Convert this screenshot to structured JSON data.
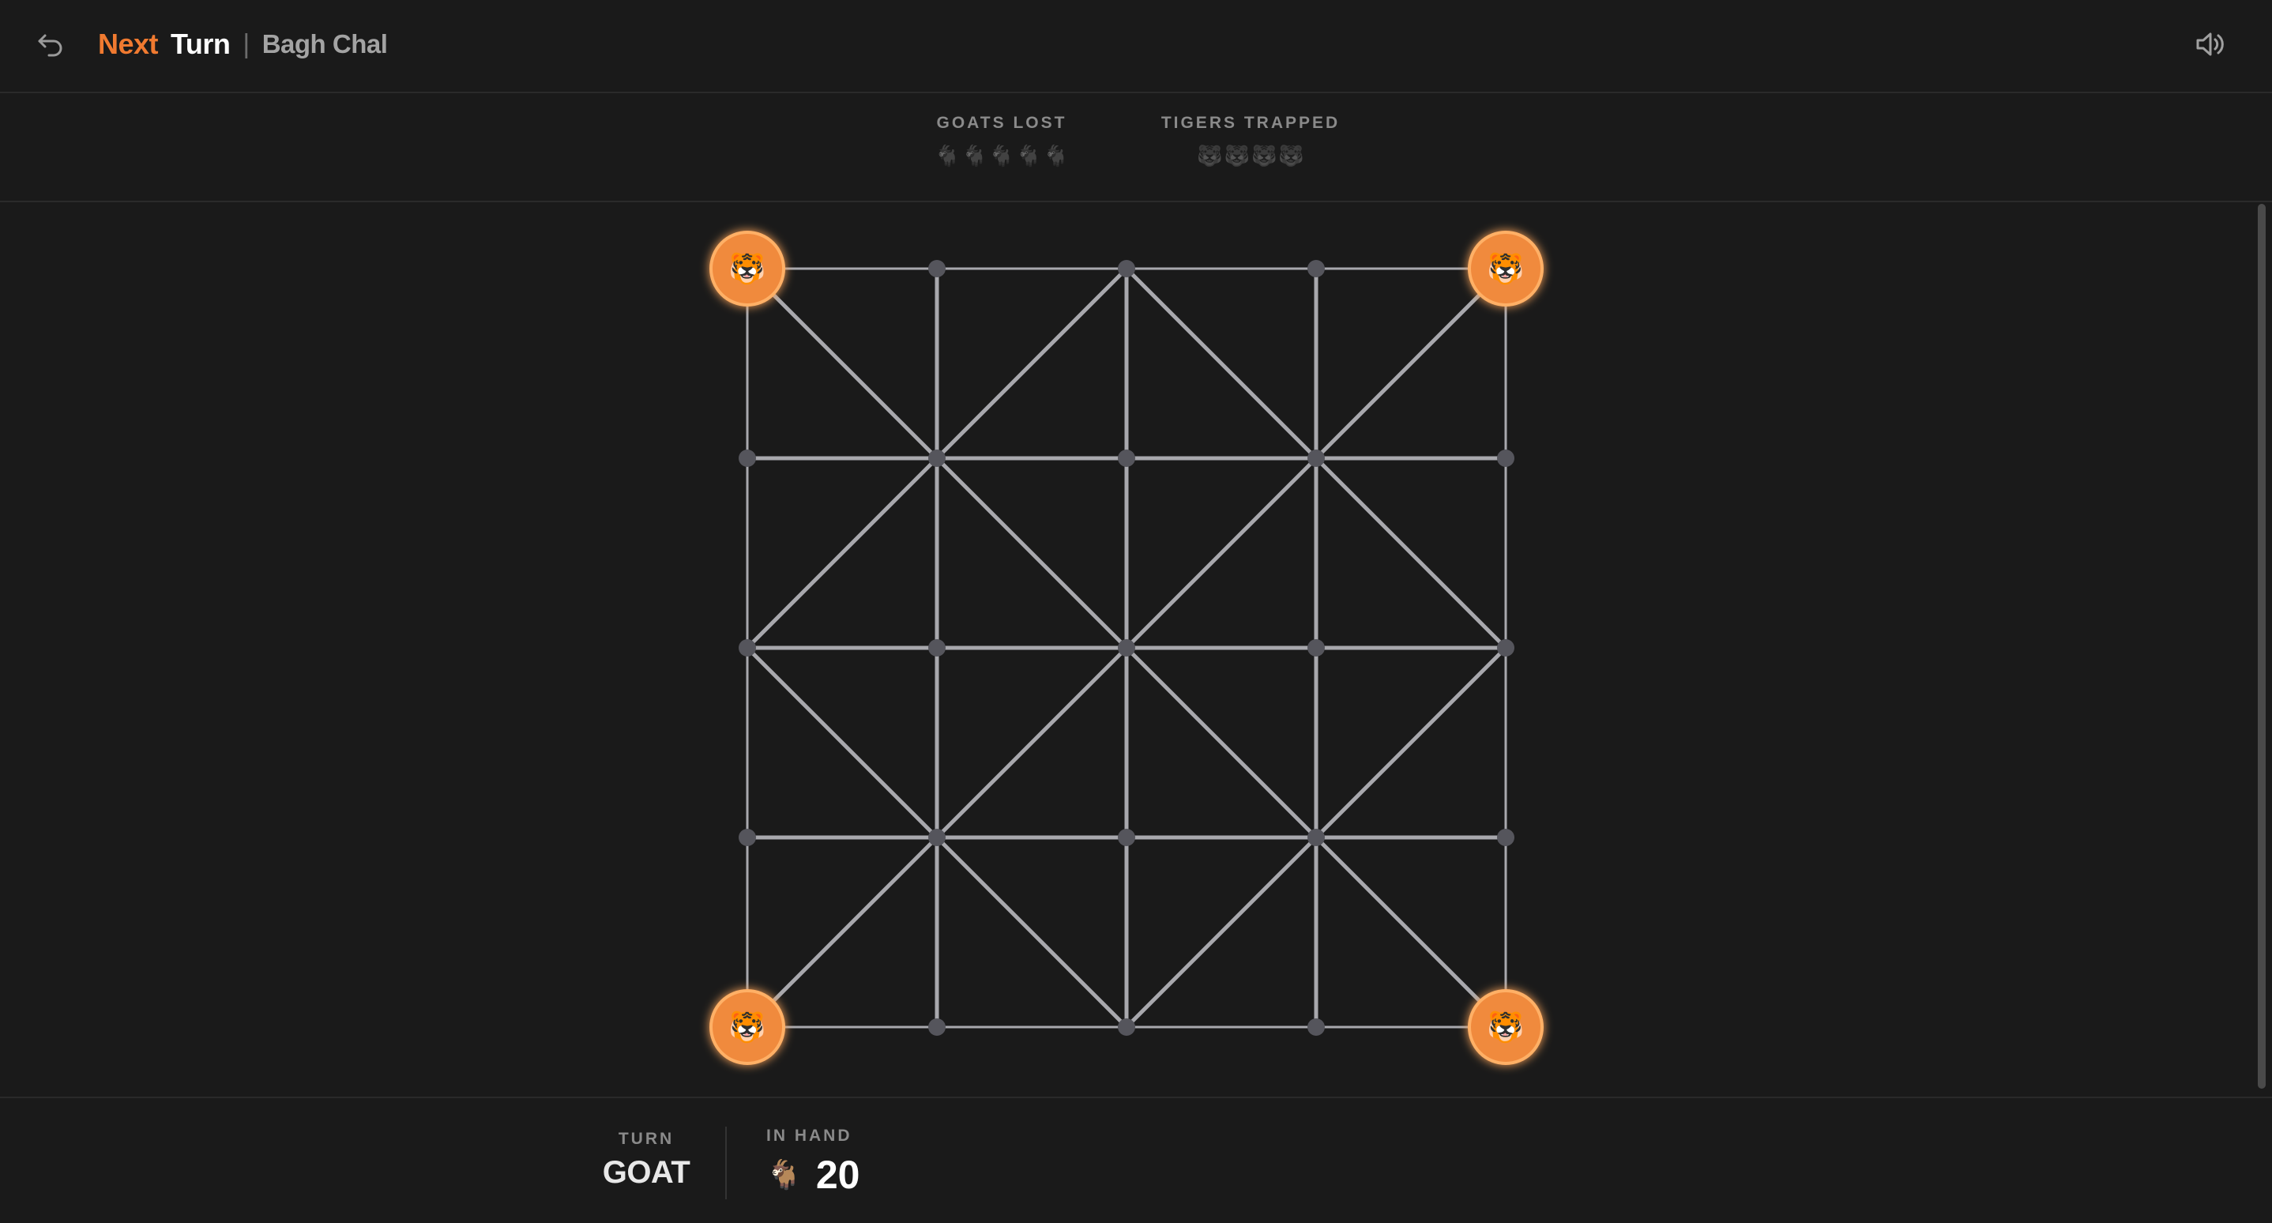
{
  "header": {
    "back_icon": "undo-arrow-icon",
    "brand_next": "Next",
    "brand_turn": "Turn",
    "separator": "|",
    "game_title": "Bagh Chal",
    "sound_icon": "speaker-icon"
  },
  "stats": {
    "goats_lost_label": "GOATS LOST",
    "goats_lost_pips": [
      "🐐",
      "🐐",
      "🐐",
      "🐐",
      "🐐"
    ],
    "tigers_trapped_label": "TIGERS TRAPPED",
    "tigers_trapped_pips": [
      "🐯",
      "🐯",
      "🐯",
      "🐯"
    ]
  },
  "board": {
    "size": 5,
    "tigers": [
      {
        "row": 0,
        "col": 0,
        "glyph": "🐯"
      },
      {
        "row": 0,
        "col": 4,
        "glyph": "🐯"
      },
      {
        "row": 4,
        "col": 0,
        "glyph": "🐯"
      },
      {
        "row": 4,
        "col": 4,
        "glyph": "🐯"
      }
    ],
    "colors": {
      "line": "#a8a8ad",
      "node": "#55555c",
      "tiger_fill": "#f08a3c",
      "tiger_ring": "#ffb066",
      "accent": "#f07a30"
    }
  },
  "footer": {
    "turn_label": "TURN",
    "turn_value": "GOAT",
    "in_hand_label": "IN HAND",
    "in_hand_icon": "🐐",
    "in_hand_count": "20"
  }
}
